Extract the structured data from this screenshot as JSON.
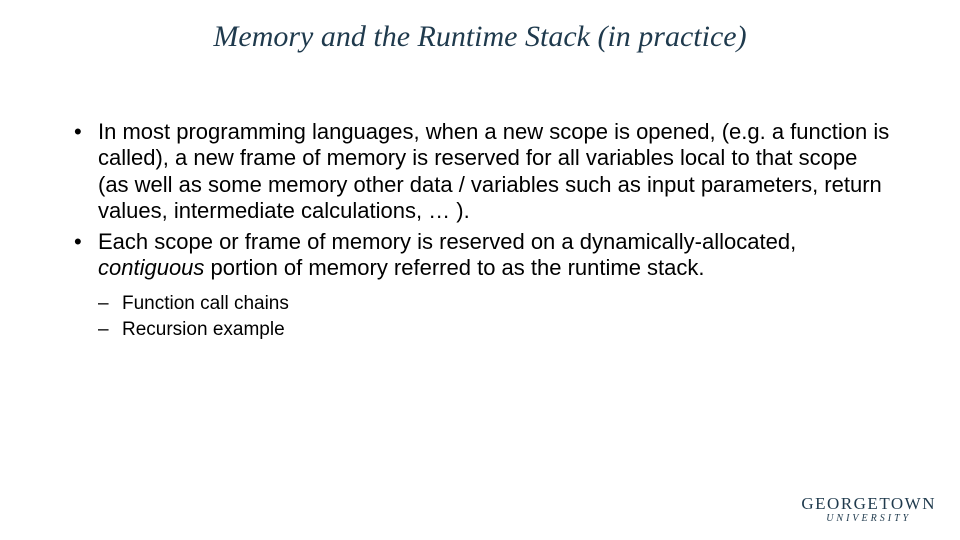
{
  "title": "Memory and the Runtime Stack (in practice)",
  "bullets": {
    "b1_part1": "In most programming languages, when a new scope is opened, (e.g. a function is called), a new frame of memory is reserved for all variables local to that scope (as well as some memory other data / variables such as input parameters, return values, intermediate calculations, … ).",
    "b2_part1": "Each scope or frame of memory is reserved on a dynamically-allocated, ",
    "b2_italic": "contiguous",
    "b2_part2": " portion of memory referred to as the runtime stack."
  },
  "subbullets": {
    "s1": "Function call chains",
    "s2": "Recursion example"
  },
  "logo": {
    "main_prefix": "G",
    "main_rest": "EORGETOWN",
    "sub": "UNIVERSITY"
  }
}
